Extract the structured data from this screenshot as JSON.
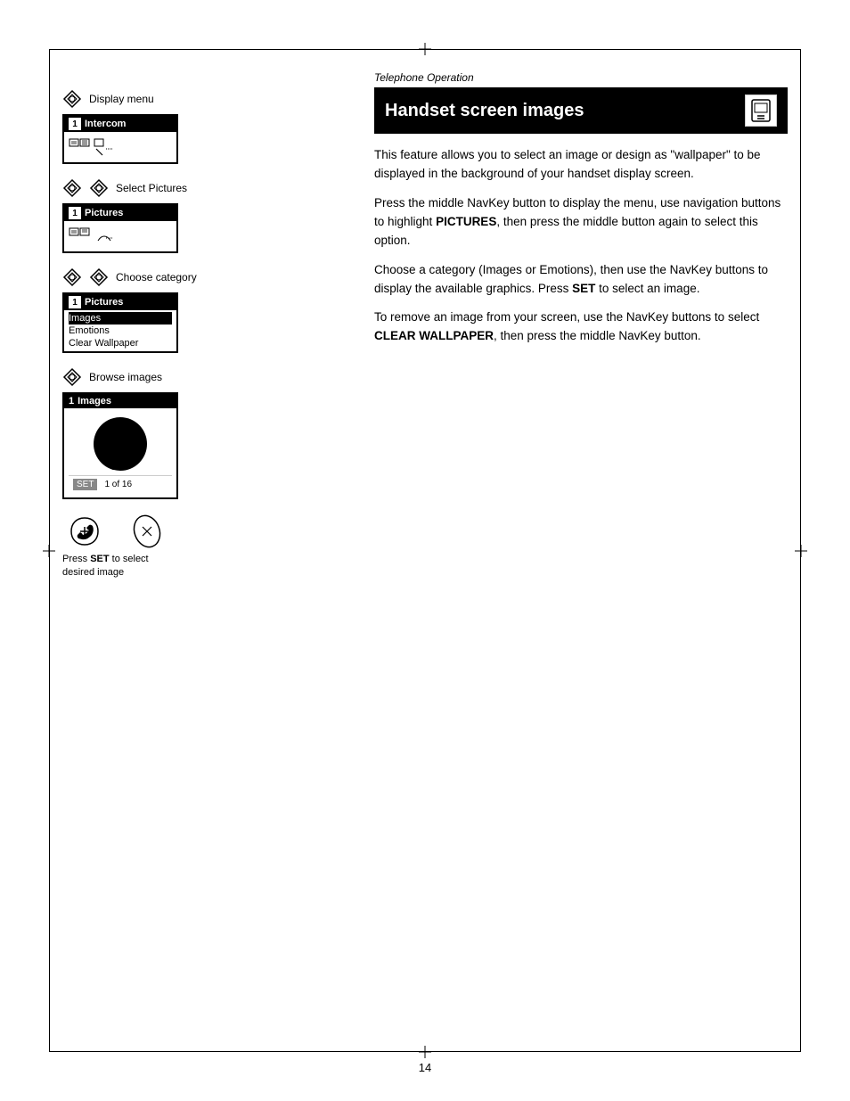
{
  "page": {
    "number": "14",
    "section_label": "Telephone Operation",
    "title": "Handset screen images",
    "body_paragraphs": [
      "This feature allows you to select an image or design as \"wallpaper\" to be displayed in the background of your handset display screen.",
      "Press the middle NavKey button to display the menu, use navigation buttons to highlight PICTURES, then press the middle button again to select this option.",
      "Choose a category (Images or Emotions), then use the NavKey buttons to display the available graphics. Press SET to select an image.",
      "To remove an image from your screen, use the NavKey buttons to select CLEAR WALLPAPER, then press the middle NavKey button."
    ],
    "bold_words": [
      "PICTURES",
      "SET",
      "CLEAR WALLPAPER"
    ],
    "diagrams": [
      {
        "nav_label": "Display menu",
        "screen_title": "Intercom",
        "screen_num": "1"
      },
      {
        "nav_label": "Select Pictures",
        "screen_title": "Pictures",
        "screen_num": "1"
      },
      {
        "nav_label": "Choose category",
        "screen_title": "Pictures",
        "screen_num": "1",
        "menu_items": [
          "Images",
          "Emotions",
          "Clear Wallpaper"
        ],
        "selected_item": 0
      },
      {
        "nav_label": "Browse images",
        "screen_title": "Images",
        "screen_num": "1",
        "has_image": true,
        "image_counter": "1 of 16"
      }
    ],
    "caption": "Press SET to select desired image"
  }
}
